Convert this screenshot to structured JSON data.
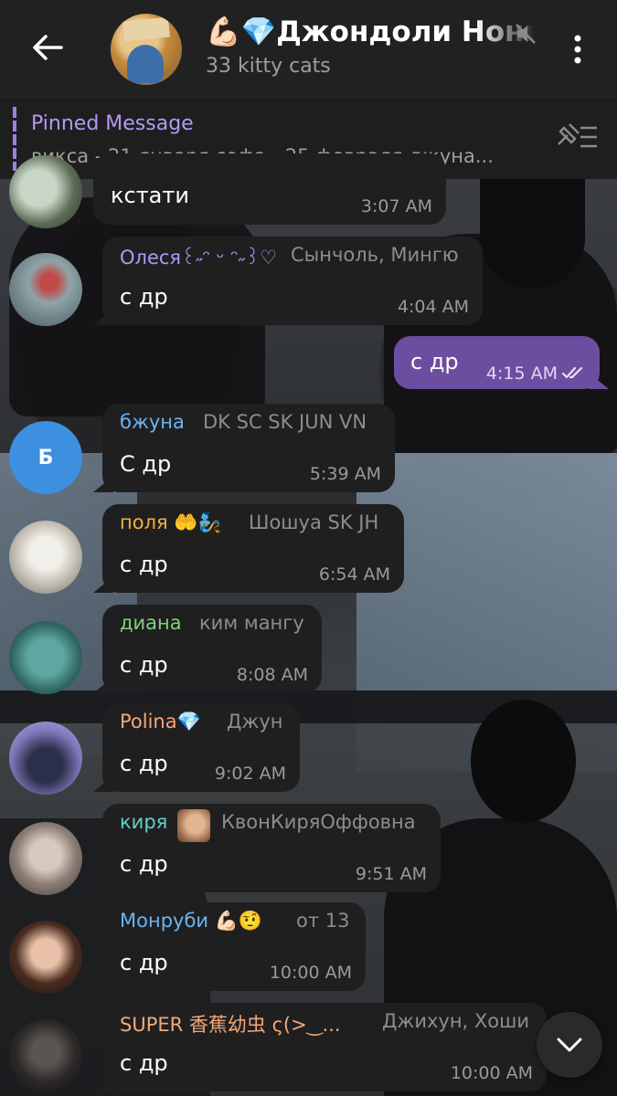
{
  "header": {
    "title": "💪🏻💎Джондоли Нони",
    "subtitle": "33 kitty cats",
    "muted": true,
    "back_icon": "arrow-left-icon",
    "menu_icon": "more-vertical-icon"
  },
  "pinned": {
    "label": "Pinned Message",
    "text": "викса - 21 января софа - 25 февраля джуна..."
  },
  "messages": [
    {
      "name": "",
      "rank": "",
      "text": "кстати",
      "time": "3:07 AM"
    },
    {
      "name": "Олеся꒰˶ᵔ ᵕ ᵔ˶꒱♡",
      "name_color": "#a99cf3",
      "rank": "Сынчоль, Мингю",
      "text": "с др",
      "time": "4:04 AM"
    },
    {
      "outgoing": true,
      "text": "с др",
      "time": "4:15 AM",
      "status": "read"
    },
    {
      "name": "бжуна",
      "name_color": "#6bb4f0",
      "rank": "DK SC SK JUN VN",
      "text": "С др",
      "time": "5:39 AM",
      "avatar_letter": "Б",
      "avatar_color": "#3d8fe0"
    },
    {
      "name": "поля 🤲🧞",
      "name_color": "#f2b03c",
      "rank": "Шошуа SK JH",
      "text": "с др",
      "time": "6:54 AM"
    },
    {
      "name": "диана",
      "name_color": "#7fd17b",
      "rank": "ким мангу",
      "text": "с др",
      "time": "8:08 AM"
    },
    {
      "name": "Polina💎",
      "name_color": "#f4a877",
      "rank": "Джун",
      "text": "с др",
      "time": "9:02 AM"
    },
    {
      "name": "киря",
      "name_color": "#5ed3c7",
      "rank": "КвонКиряОффовна",
      "text": "с др",
      "time": "9:51 AM"
    },
    {
      "name": "Монруби 💪🏻🤨",
      "name_color": "#6bb4f0",
      "rank": "от 13",
      "text": "с др",
      "time": "10:00 AM"
    },
    {
      "name": "SUPER 香蕉幼虫 ς(>‿...",
      "name_color": "#f4a877",
      "rank": "Джихун, Хоши",
      "text": "с др",
      "time": "10:00 AM"
    }
  ]
}
